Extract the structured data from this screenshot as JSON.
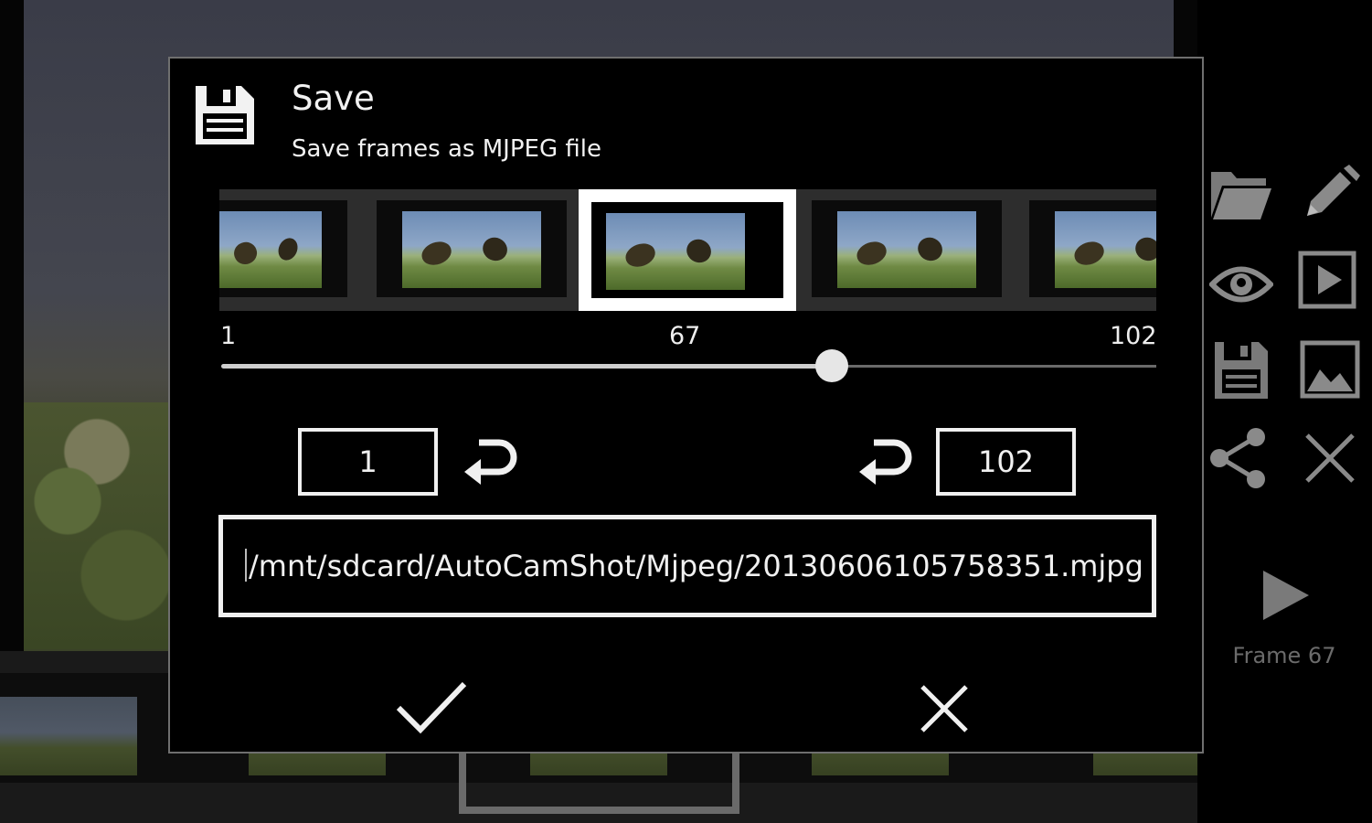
{
  "dialog": {
    "title": "Save",
    "subtitle": "Save frames as MJPEG file",
    "range": {
      "min": "1",
      "current": "67",
      "max": "102",
      "position_fraction": 0.65
    },
    "start_frame_value": "1",
    "end_frame_value": "102",
    "file_path": "/mnt/sdcard/AutoCamShot/Mjpeg/20130606105758351.mjpg",
    "icons": {
      "header": "floppy-disk-icon",
      "set_start": "turn-back-icon",
      "set_end": "turn-back-icon",
      "confirm": "check-icon",
      "cancel": "close-icon"
    }
  },
  "side_toolbar": {
    "icons": [
      "folder-icon",
      "pencil-icon",
      "eye-icon",
      "play-box-icon",
      "floppy-disk-icon",
      "image-icon",
      "share-icon",
      "close-icon",
      "play-icon"
    ],
    "frame_label": "Frame 67"
  },
  "colors": {
    "background": "#000000",
    "dialog_border": "#6f6f6f",
    "foreground": "#f0f0f0",
    "muted": "#6b6b6b"
  }
}
